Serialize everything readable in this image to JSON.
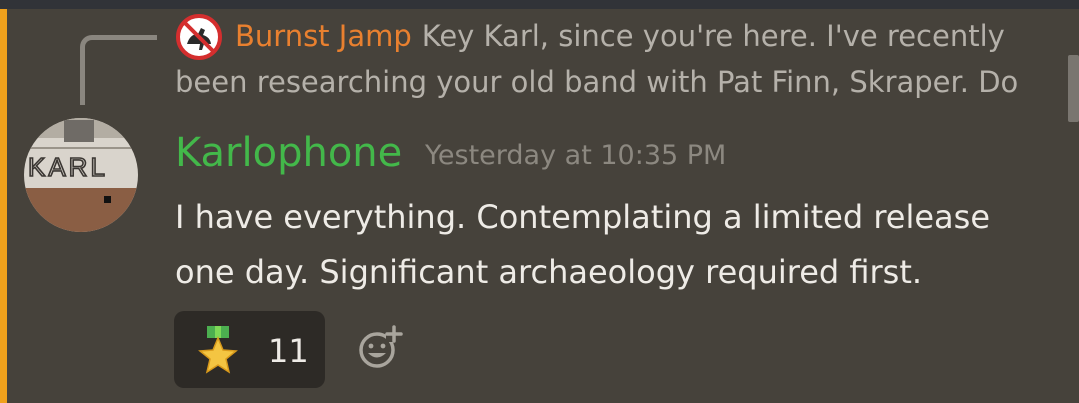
{
  "reply": {
    "author": "Burnst Jamp",
    "text": "Key Karl, since you're here. I've recently been researching your old band with Pat Finn, Skraper. Do"
  },
  "message": {
    "author": "Karlophone",
    "timestamp": "Yesterday at 10:35 PM",
    "text": "I have everything. Contemplating a limited release one day. Significant archaeology required first.",
    "avatar_sign_text": "KARL"
  },
  "reactions": [
    {
      "emoji": "star-medal-icon",
      "count": "11"
    }
  ],
  "colors": {
    "background": "#46423b",
    "accent_bar": "#f0a11c",
    "reply_author": "#e9802f",
    "author": "#43b84a",
    "reaction_bg": "#2d2a26"
  }
}
